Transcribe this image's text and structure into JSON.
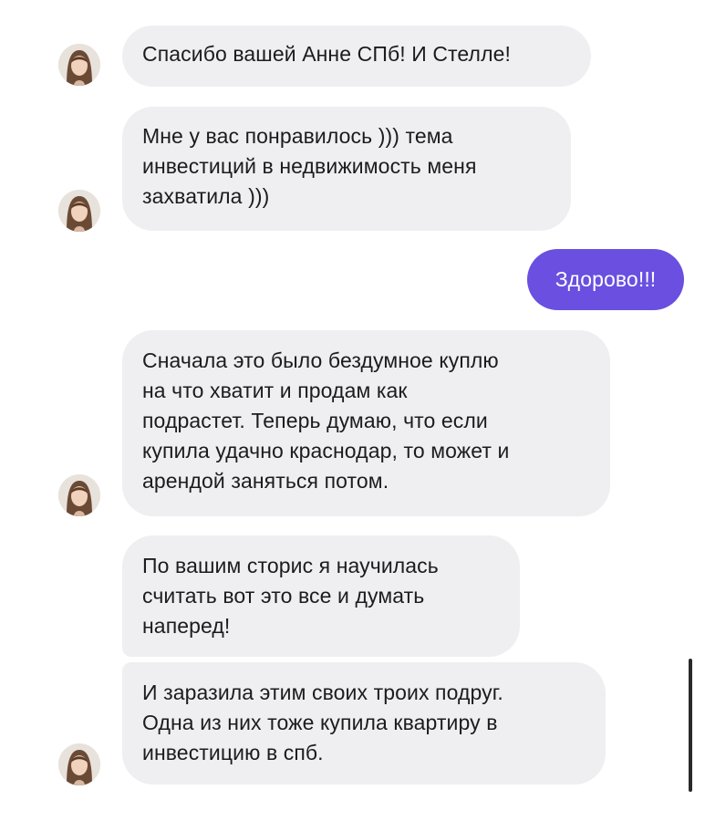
{
  "conversation": {
    "messages": [
      {
        "direction": "in",
        "text": "Спасибо вашей Анне СПб! И Стелле!"
      },
      {
        "direction": "in",
        "text": "Мне у вас понравилось ))) тема\nинвестиций в недвижимость меня\nзахватила )))"
      },
      {
        "direction": "out",
        "text": "Здорово!!!"
      },
      {
        "direction": "in",
        "text": "Сначала это было бездумное куплю\nна что хватит и продам как\nподрастет. Теперь думаю, что если\nкупила удачно краснодар, то может и\nарендой заняться потом."
      },
      {
        "direction": "in",
        "text": "По вашим сторис я научилась\nсчитать вот это все и думать\nнаперед!"
      },
      {
        "direction": "in",
        "text": "И заразила этим своих троих подруг.\nОдна из них тоже купила квартиру в\nинвестицию в спб."
      }
    ]
  },
  "colors": {
    "incoming_bubble": "#efeff2",
    "outgoing_bubble": "#6a4fe0",
    "incoming_text": "#1c1c1e",
    "outgoing_text": "#ffffff"
  },
  "icons": {
    "avatar": "user-avatar-photo"
  }
}
